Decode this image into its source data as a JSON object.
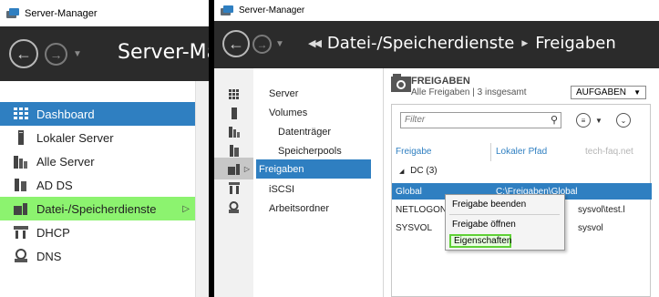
{
  "left": {
    "title_bar": "Server-Manager",
    "header_title": "Server-Ma",
    "nav": [
      {
        "label": "Dashboard",
        "icon": "dashboard-grid-icon"
      },
      {
        "label": "Lokaler Server",
        "icon": "server-icon"
      },
      {
        "label": "Alle Server",
        "icon": "servers-icon"
      },
      {
        "label": "AD DS",
        "icon": "ad-ds-icon"
      },
      {
        "label": "Datei-/Speicherdienste",
        "icon": "file-storage-icon"
      },
      {
        "label": "DHCP",
        "icon": "dhcp-icon"
      },
      {
        "label": "DNS",
        "icon": "dns-icon"
      }
    ]
  },
  "right": {
    "title_bar": "Server-Manager",
    "breadcrumb": [
      "Datei-/Speicherdienste",
      "Freigaben"
    ],
    "sub_nav": [
      "Server",
      "Volumes",
      "Datenträger",
      "Speicherpools",
      "Freigaben",
      "iSCSI",
      "Arbeitsordner"
    ],
    "panel": {
      "title": "FREIGABEN",
      "subtitle": "Alle Freigaben | 3 insgesamt",
      "tasks": "AUFGABEN",
      "filter_placeholder": "Filter",
      "columns": [
        "Freigabe",
        "Lokaler Pfad"
      ],
      "watermark": "tech-faq.net",
      "group": "DC (3)",
      "rows": [
        {
          "name": "Global",
          "path": "C:\\Freigaben\\Global"
        },
        {
          "name": "NETLOGON",
          "path": "sysvol\\test.l"
        },
        {
          "name": "SYSVOL",
          "path": "sysvol"
        }
      ]
    },
    "context_menu": [
      "Freigabe beenden",
      "Freigabe öffnen",
      "Eigenschaften"
    ]
  },
  "colors": {
    "accent": "#2f7fc1",
    "header": "#2b2b2b",
    "highlight_green": "#8cf36f"
  }
}
